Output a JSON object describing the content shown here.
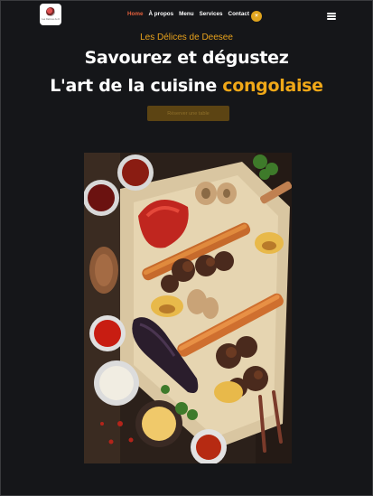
{
  "navbar": {
    "logo_text": "Les Délices de Deesee",
    "links": [
      "Home",
      "À propos",
      "Menu",
      "Services",
      "Contact"
    ],
    "active": "Home",
    "lang_icon": "sun-icon",
    "menu_icon": "hamburger-icon"
  },
  "hero": {
    "tagline": "Les Délices de Deesee",
    "title_line1": "Savourez et dégustez",
    "title_line2_main": "L'art de la cuisine ",
    "title_line2_accent": "congolaise",
    "cta_label": "Réserver une table"
  },
  "colors": {
    "background": "#151619",
    "accent": "#f0a818",
    "active_link": "#e35f3c"
  }
}
